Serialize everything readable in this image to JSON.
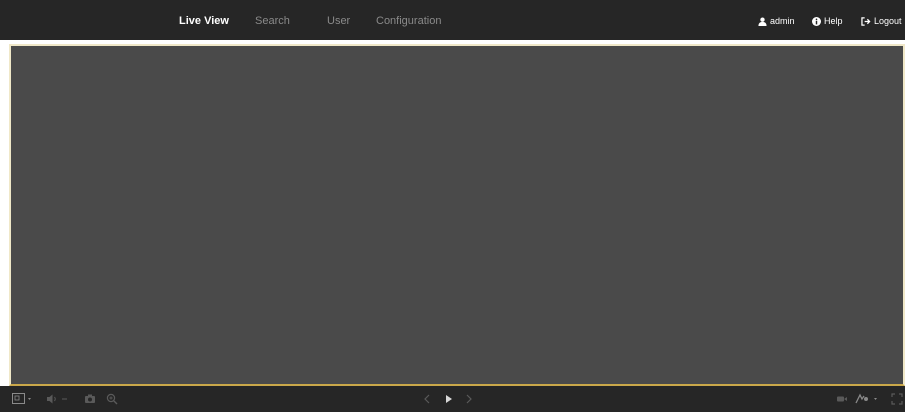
{
  "nav": {
    "items": [
      {
        "label": "Live View",
        "active": true
      },
      {
        "label": "Search",
        "active": false
      },
      {
        "label": "User",
        "active": false
      },
      {
        "label": "Configuration",
        "active": false
      }
    ]
  },
  "account": {
    "username": "admin",
    "help_label": "Help",
    "logout_label": "Logout"
  },
  "icons": {
    "user": "user-icon",
    "help": "info-circle-icon",
    "logout": "logout-icon",
    "layout": "window-layout-icon",
    "audio": "speaker-icon",
    "snapshot": "camera-icon",
    "zoom": "zoom-icon",
    "prev": "chevron-left-icon",
    "play": "play-icon",
    "next": "chevron-right-icon",
    "record": "record-icon",
    "stream": "stream-quality-icon",
    "fullscreen": "fullscreen-icon"
  },
  "colors": {
    "topbar": "#262626",
    "video_bg": "#4a4a4a",
    "video_border_accent": "#caa84a",
    "nav_active": "#ffffff",
    "nav_inactive": "#8a8a8a"
  }
}
